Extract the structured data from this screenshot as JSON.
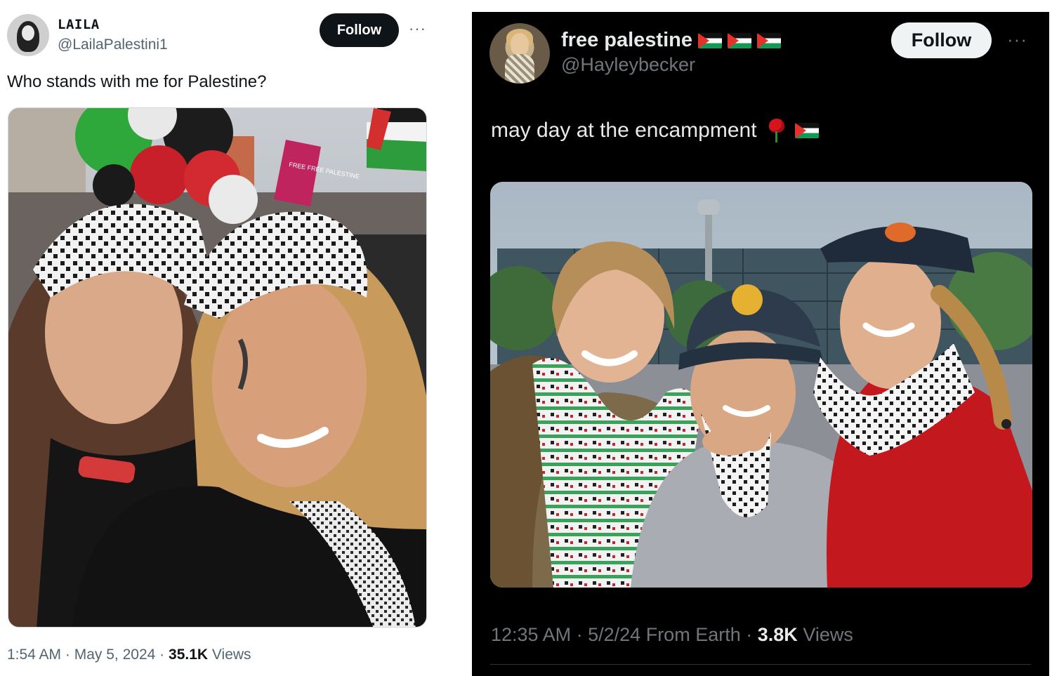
{
  "left_tweet": {
    "display_name": "LAILA",
    "handle": "@LailaPalestini1",
    "follow_label": "Follow",
    "more_label": "···",
    "text": "Who stands with me for Palestine?",
    "meta": {
      "time": "1:54 AM",
      "date": "May 5, 2024",
      "views_count": "35.1K",
      "views_label": "Views",
      "sep": "·"
    },
    "photo": {
      "sign_text": "FREE FREE PALESTINE"
    }
  },
  "right_tweet": {
    "display_name": "free palestine",
    "name_emojis": [
      "flag-ps",
      "flag-ps",
      "flag-ps"
    ],
    "handle": "@Hayleybecker",
    "follow_label": "Follow",
    "more_label": "···",
    "text": "may day at the encampment",
    "text_emojis": [
      "rose",
      "flag-ps"
    ],
    "meta": {
      "time": "12:35 AM",
      "date": "5/2/24",
      "source": "From Earth",
      "views_count": "3.8K",
      "views_label": "Views",
      "sep": "·"
    }
  },
  "colors": {
    "light_text": "#0f1419",
    "light_secondary": "#536471",
    "dark_bg": "#000000",
    "dark_text": "#e7e9ea",
    "dark_secondary": "#71767b",
    "flag_red": "#e4312b",
    "flag_green": "#149954"
  }
}
